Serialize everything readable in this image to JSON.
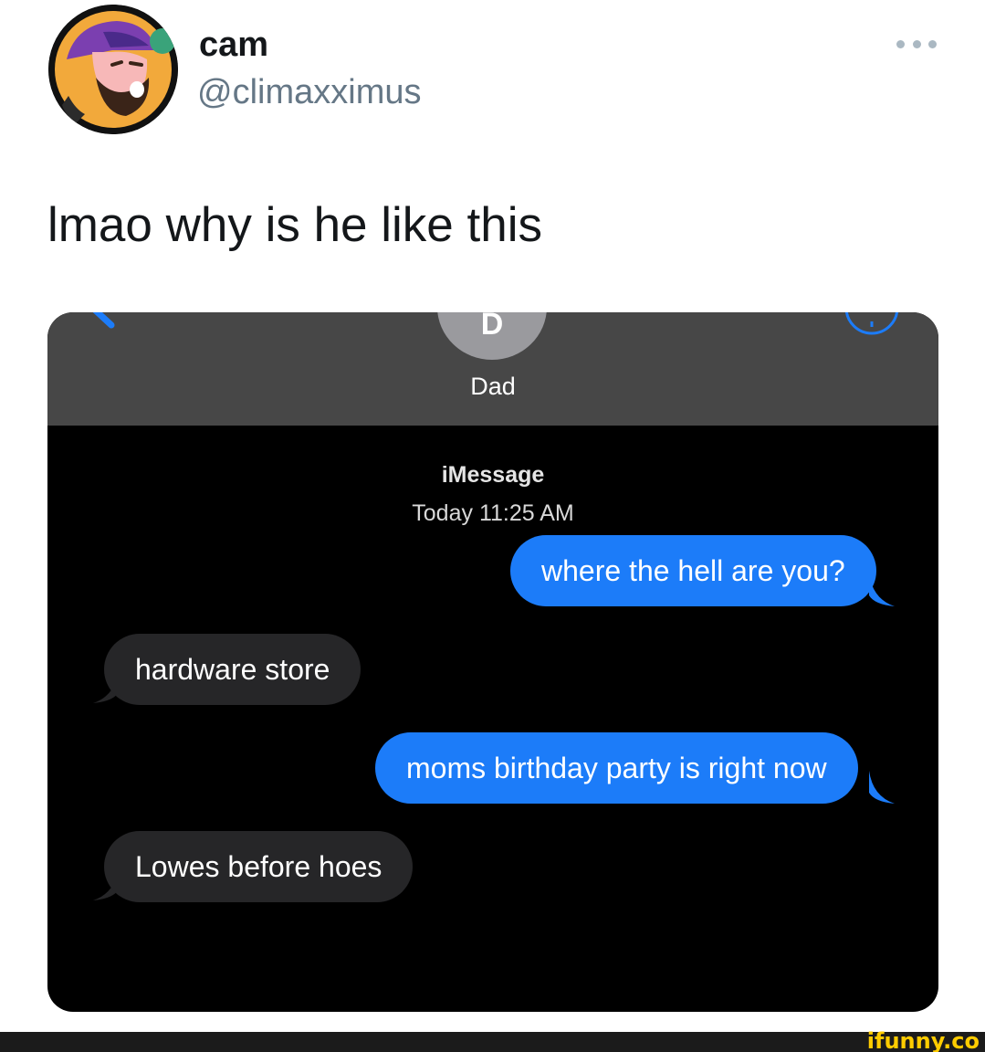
{
  "tweet": {
    "author": {
      "display_name": "cam",
      "handle": "@climaxximus"
    },
    "text": "lmao why is he like this",
    "more_icon": "ellipsis-icon"
  },
  "imessage": {
    "contact_initial": "D",
    "contact_name": "Dad",
    "service": "iMessage",
    "timestamp": "Today 11:25 AM",
    "colors": {
      "sent_bubble": "#1c7cf9",
      "received_bubble": "#262628",
      "header": "#474747",
      "background": "#000000"
    },
    "messages": [
      {
        "direction": "sent",
        "text": "where the hell are you?"
      },
      {
        "direction": "received",
        "text": "hardware store"
      },
      {
        "direction": "sent",
        "text": "moms birthday party is right now"
      },
      {
        "direction": "received",
        "text": "Lowes before hoes"
      }
    ]
  },
  "watermark": {
    "text": "ifunny.co",
    "color": "#ffcc00"
  }
}
